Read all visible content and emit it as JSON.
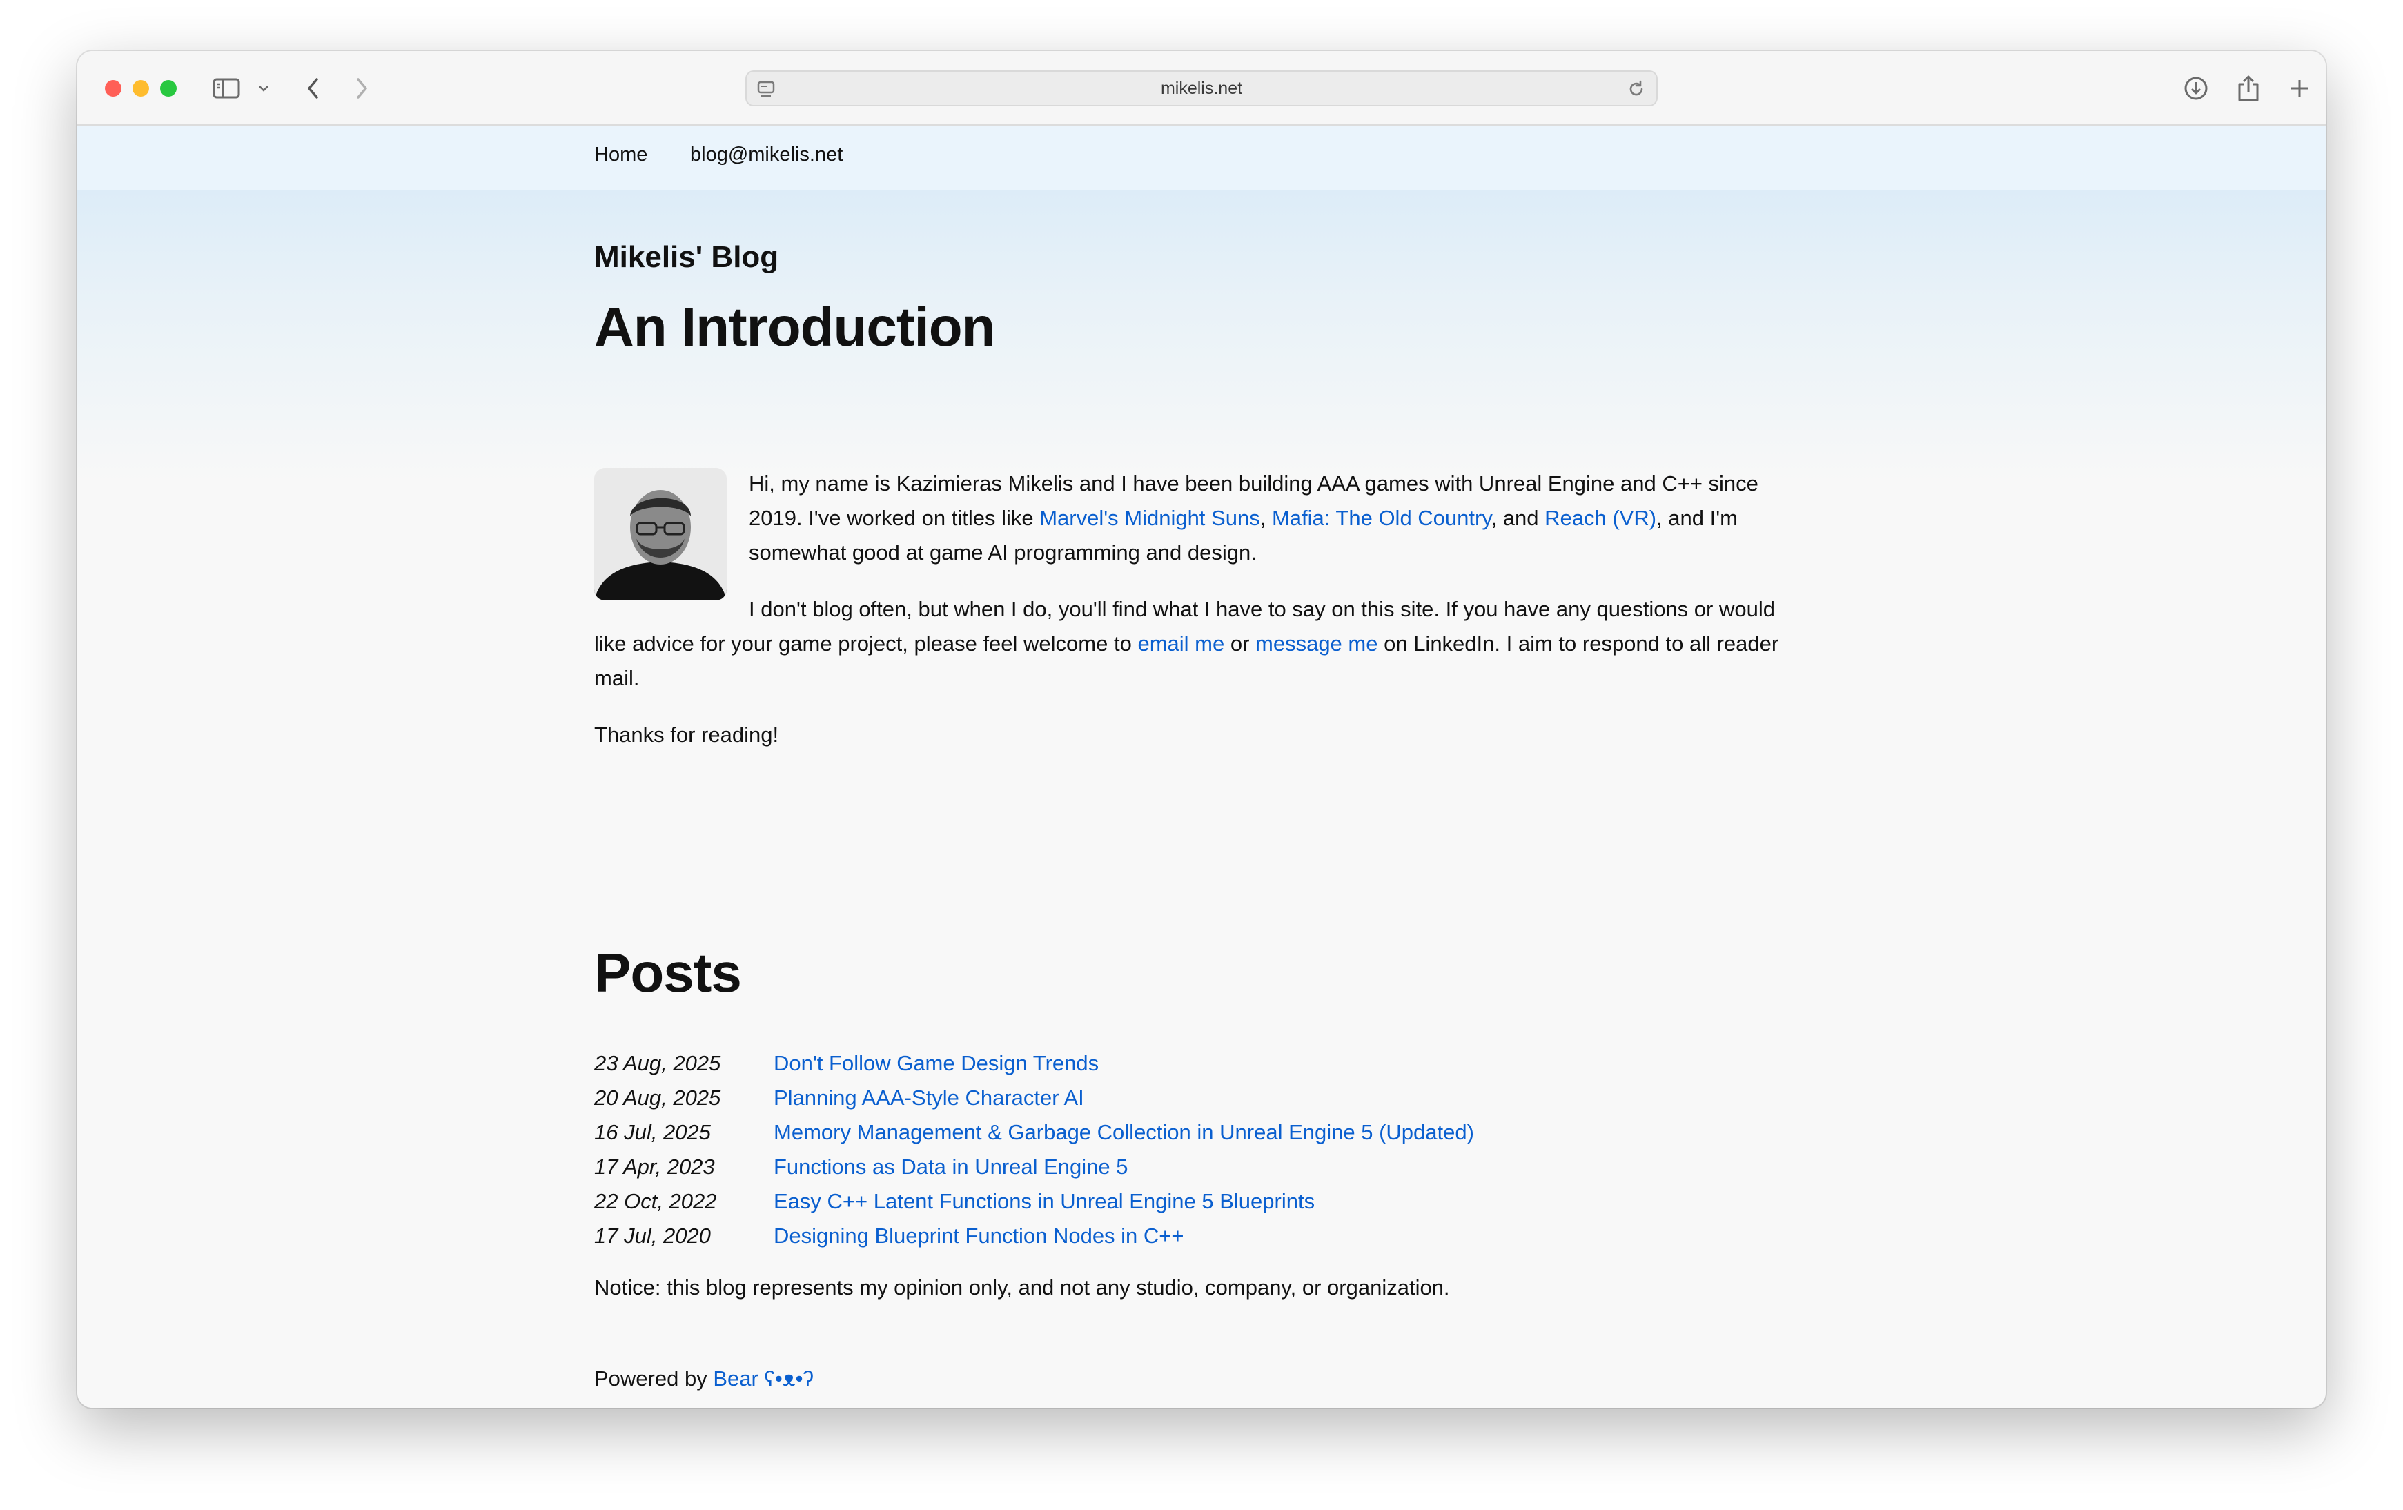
{
  "browser": {
    "url": "mikelis.net"
  },
  "nav": {
    "home": "Home",
    "email": "blog@mikelis.net"
  },
  "site_title": "Mikelis' Blog",
  "intro": {
    "heading": "An Introduction",
    "p1_a": "Hi, my name is Kazimieras Mikelis and I have been building AAA games with Unreal Engine and C++ since 2019. I've worked on titles like ",
    "link_suns": "Marvel's Midnight Suns",
    "p1_b": ", ",
    "link_mafia": "Mafia: The Old Country",
    "p1_c": ", and ",
    "link_reach": "Reach (VR)",
    "p1_d": ", and I'm somewhat good at game AI programming and design.",
    "p2_a": "I don't blog often, but when I do, you'll find what I have to say on this site. If you have any questions or would like advice for your game project, please feel welcome to ",
    "link_email": "email me",
    "p2_b": " or ",
    "link_message": "message me",
    "p2_c": " on LinkedIn. I aim to respond to all reader mail.",
    "p3": "Thanks for reading!"
  },
  "posts": {
    "heading": "Posts",
    "items": [
      {
        "date": "23 Aug, 2025",
        "title": "Don't Follow Game Design Trends"
      },
      {
        "date": "20 Aug, 2025",
        "title": "Planning AAA-Style Character AI"
      },
      {
        "date": "16 Jul, 2025",
        "title": "Memory Management & Garbage Collection in Unreal Engine 5 (Updated)"
      },
      {
        "date": "17 Apr, 2023",
        "title": "Functions as Data in Unreal Engine 5"
      },
      {
        "date": "22 Oct, 2022",
        "title": "Easy C++ Latent Functions in Unreal Engine 5 Blueprints"
      },
      {
        "date": "17 Jul, 2020",
        "title": "Designing Blueprint Function Nodes in C++"
      }
    ]
  },
  "notice": "Notice: this blog represents my opinion only, and not any studio, company, or organization.",
  "footer": {
    "powered_prefix": "Powered by ",
    "powered_link": "Bear ʕ•ᴥ•ʔ"
  },
  "colors": {
    "link": "#0a5fcf",
    "nav_bg": "#eaf4fc",
    "header_gradient_top": "#d6e9f8",
    "page_bg": "#f8f8f8"
  }
}
